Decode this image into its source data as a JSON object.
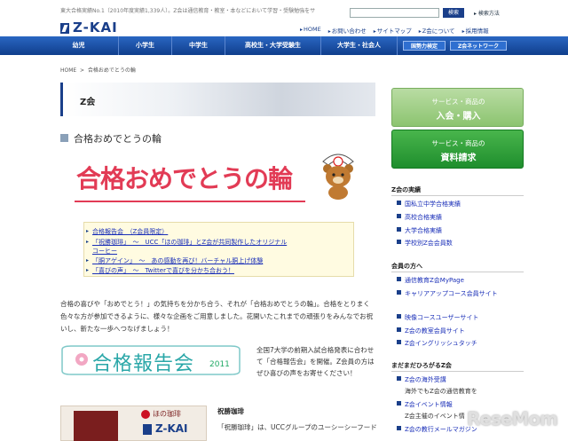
{
  "header": {
    "tagline": "東大合格実績No.1（2010年度実績1,339人）。Z会は通信教育・教室・本などにおいて学習・受験勉強をサ",
    "search_placeholder": "",
    "search_button": "検索",
    "search_help": "検索方法",
    "logo": "Z-KAI",
    "util_links": [
      "HOME",
      "お問い合わせ",
      "サイトマップ",
      "Z会について",
      "採用情報"
    ]
  },
  "nav": {
    "items": [
      "幼児",
      "小学生",
      "中学生",
      "高校生・大学受験生",
      "大学生・社会人"
    ],
    "buttons": [
      "国勢力検定",
      "Z会ネットワーク"
    ]
  },
  "breadcrumb": {
    "home": "HOME",
    "sep": ">",
    "current": "合格おめでとうの輪"
  },
  "banner": {
    "title": "Z会"
  },
  "section": {
    "title": "合格おめでとうの輪"
  },
  "hero": {
    "text": "合格おめでとうの輪"
  },
  "links": [
    "合格報告会　（Z会員限定）",
    "「祝勝珈琲」　～　UCC「ほの珈琲」とZ会が共同製作したオリジナル",
    "コーヒー",
    "「胴アゲイン」　～　あの感動を再び！バーチャル胴上げ体験",
    "「喜びの声」　～　Twitterで喜びを分かち合おう！"
  ],
  "intro": "合格の喜びや「おめでとう！」の気持ちを分かち合う、それが「合格おめでとうの輪」。合格をとりまく色々な方が参加できるように、様々な企画をご用意しました。花開いたこれまでの頑張りをみんなでお祝いし、新たな一歩へつなげましょう！",
  "houkoku": {
    "title": "合格報告会",
    "year": "2011",
    "desc": "全国7大学の前期入試合格発表に合わせて「合格報告会」を開催。Z会員の方はぜひ喜びの声をお寄せください！"
  },
  "cafe": {
    "img_label": "ほの珈琲",
    "title": "祝勝珈琲",
    "desc": "「祝勝珈琲」は、UCCグループのユーシーシーフードサービスシステムズ株式会社が運営するコー"
  },
  "sidebar": {
    "btn1": {
      "line1": "サービス・商品の",
      "line2": "入会・購入"
    },
    "btn2": {
      "line1": "サービス・商品の",
      "line2": "資料請求"
    },
    "sections": [
      {
        "title": "Z会の実績",
        "items": [
          "国私立中学合格実績",
          "高校合格実績",
          "大学合格実績",
          "学校別Z会会員数"
        ]
      },
      {
        "title": "会員の方へ",
        "items": [
          "通信教育Z会MyPage",
          "キャリアアップコース会員サイト",
          "映像コースユーザーサイト",
          "Z会の教室会員サイト",
          "Z会イングリッシュタッチ"
        ]
      },
      {
        "title": "まだまだひろがるZ会",
        "items": [
          "Z会の海外受講",
          "Z会イベント情報",
          "Z会の教行メールマガジン"
        ],
        "subs": [
          "海外でもZ会の通信教育を",
          "Z会主催のイベント情"
        ]
      }
    ]
  },
  "watermark": "ReseMom"
}
